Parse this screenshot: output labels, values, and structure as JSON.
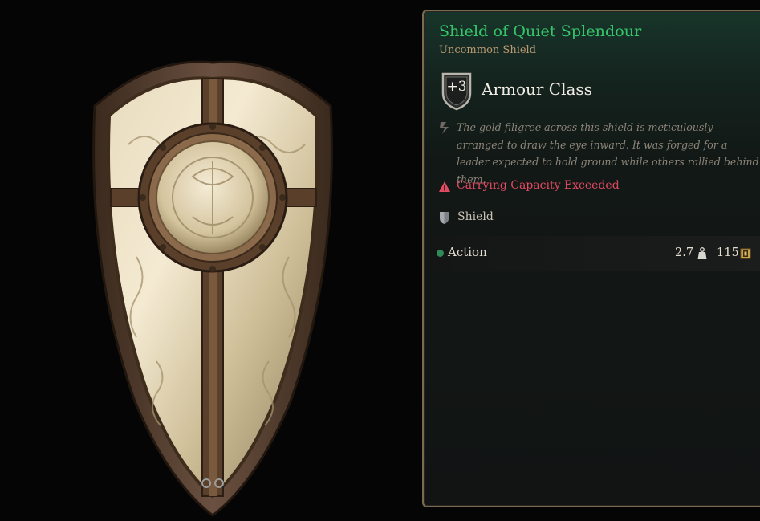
{
  "item": {
    "name": "Shield of Quiet Splendour",
    "type": "Uncommon Shield",
    "rarity_color": "#36c66a"
  },
  "armour": {
    "value": "+3",
    "label": "Armour Class"
  },
  "description": "The gold filigree across this shield is meticulously arranged to draw the eye inward. It was forged for a leader expected to hold ground while others rallied behind them.",
  "warning": {
    "text": "Carrying Capacity Exceeded",
    "color": "#e04a62"
  },
  "category": {
    "label": "Shield",
    "icon": "shield-icon"
  },
  "footer": {
    "action_label": "Action",
    "weight": "2.7",
    "weight_icon": "weight-icon",
    "price": "115",
    "price_icon": "gold-coin-icon"
  }
}
